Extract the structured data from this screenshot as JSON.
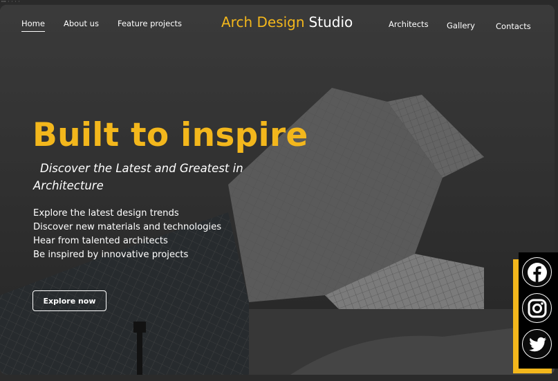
{
  "nav": {
    "left_links": [
      "Home",
      "About us",
      "Feature projects"
    ],
    "brand_part1": "Arch Design",
    "brand_part2": "Studio",
    "right_links": [
      "Architects",
      "Gallery",
      "Contacts"
    ]
  },
  "hero": {
    "title": "Built to inspire",
    "subtitle": "Discover the Latest and Greatest in Architecture",
    "bullets": [
      "Explore the latest design trends",
      "Discover new materials and technologies",
      "Hear from talented architects",
      "Be inspired by innovative projects"
    ],
    "cta": "Explore now"
  },
  "social": [
    {
      "icon": "facebook-icon"
    },
    {
      "icon": "instagram-icon"
    },
    {
      "icon": "twitter-icon"
    }
  ],
  "colors": {
    "accent": "#f3b71c",
    "text": "#ffffff",
    "panel": "#000000"
  }
}
